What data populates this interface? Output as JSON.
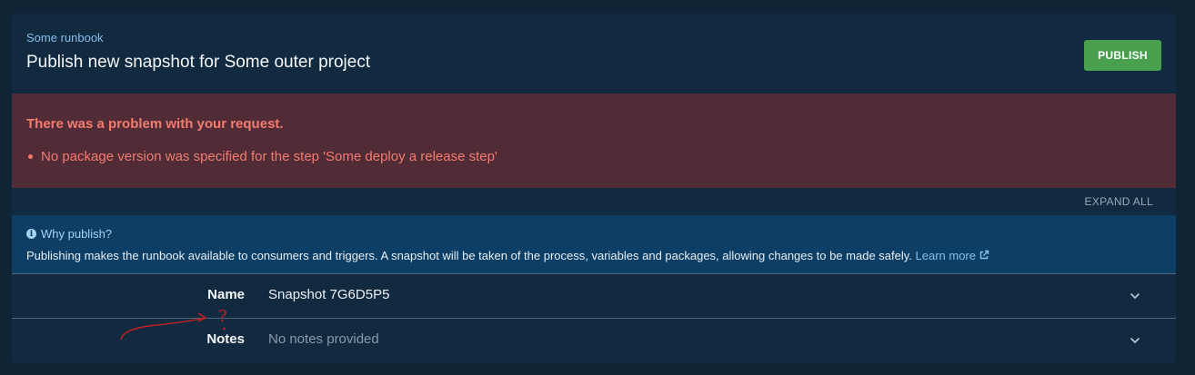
{
  "header": {
    "breadcrumb": "Some runbook",
    "title": "Publish new snapshot for Some outer project",
    "publish_label": "PUBLISH"
  },
  "error": {
    "title": "There was a problem with your request.",
    "items": [
      "No package version was specified for the step 'Some deploy a release step'"
    ]
  },
  "expand_all_label": "EXPAND ALL",
  "info": {
    "icon": "info-circle-icon",
    "title": "Why publish?",
    "body": "Publishing makes the runbook available to consumers and triggers. A snapshot will be taken of the process, variables and packages, allowing changes to be made safely.",
    "link_label": "Learn more",
    "link_icon": "external-link-icon"
  },
  "form": {
    "rows": [
      {
        "label": "Name",
        "value": "Snapshot 7G6D5P5"
      },
      {
        "label": "Notes",
        "value": "No notes provided"
      }
    ]
  },
  "annotation": {
    "mark": "?",
    "color": "#cc1f1f"
  },
  "colors": {
    "background": "#0f2535",
    "card": "#112a3f",
    "publish_button": "#48a04e",
    "error_panel": "#512c36",
    "error_text": "#f27c70",
    "info_panel": "#0d3f66",
    "link": "#87bfec"
  }
}
